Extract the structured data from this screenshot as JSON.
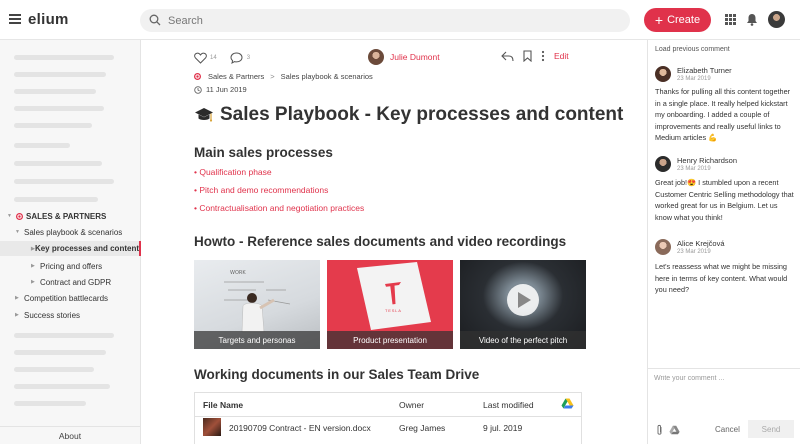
{
  "app": {
    "logo": "elium"
  },
  "search": {
    "placeholder": "Search"
  },
  "header": {
    "create_label": "Create"
  },
  "sidebar": {
    "items": [
      {
        "label": "SALES & PARTNERS"
      },
      {
        "label": "Sales playbook & scenarios"
      },
      {
        "label": "Key processes and content"
      },
      {
        "label": "Pricing and offers"
      },
      {
        "label": "Contract and GDPR"
      },
      {
        "label": "Competition battlecards"
      },
      {
        "label": "Success stories"
      }
    ],
    "about": "About"
  },
  "article": {
    "likes": "14",
    "comments_count": "3",
    "author": "Julie Dumont",
    "edit_label": "Edit",
    "breadcrumb": [
      "Sales & Partners",
      "Sales playbook & scenarios"
    ],
    "breadcrumb_sep": ">",
    "date": "11 Jun 2019",
    "title": "Sales Playbook - Key processes and content",
    "section1": "Main sales processes",
    "links": [
      "Qualification phase",
      "Pitch and demo recommendations",
      "Contractualisation and negotiation practices"
    ],
    "section2": "Howto - Reference sales documents and video recordings",
    "tiles": [
      "Targets and personas",
      "Product presentation",
      "Video of the perfect pitch"
    ],
    "tile2_word": "TESLA",
    "section3": "Working documents in our Sales Team Drive",
    "table": {
      "headers": [
        "File Name",
        "Owner",
        "Last modified"
      ],
      "rows": [
        {
          "name": "20190709 Contract - EN version.docx",
          "owner": "Greg James",
          "modified": "9 jul. 2019"
        }
      ]
    }
  },
  "comments": {
    "load_previous": "Load previous comment",
    "items": [
      {
        "name": "Elizabeth Turner",
        "date": "23 Mar 2019",
        "text": "Thanks for pulling all this content together in a single place. It really helped kickstart my onboarding. I added a couple of improvements and really useful links to Medium articles 💪"
      },
      {
        "name": "Henry Richardson",
        "date": "23 Mar 2019",
        "text": "Great job!😍 I stumbled upon a recent Customer Centric Selling methodology that worked great for us in Belgium. Let us know what you think!"
      },
      {
        "name": "Alice Krejčová",
        "date": "23 Mar 2019",
        "text": "Let's reassess what we might be missing here in terms of key content. What would you need?"
      }
    ],
    "input_placeholder": "Write your comment ...",
    "cancel_label": "Cancel",
    "send_label": "Send"
  },
  "colors": {
    "accent": "#e0324b"
  }
}
